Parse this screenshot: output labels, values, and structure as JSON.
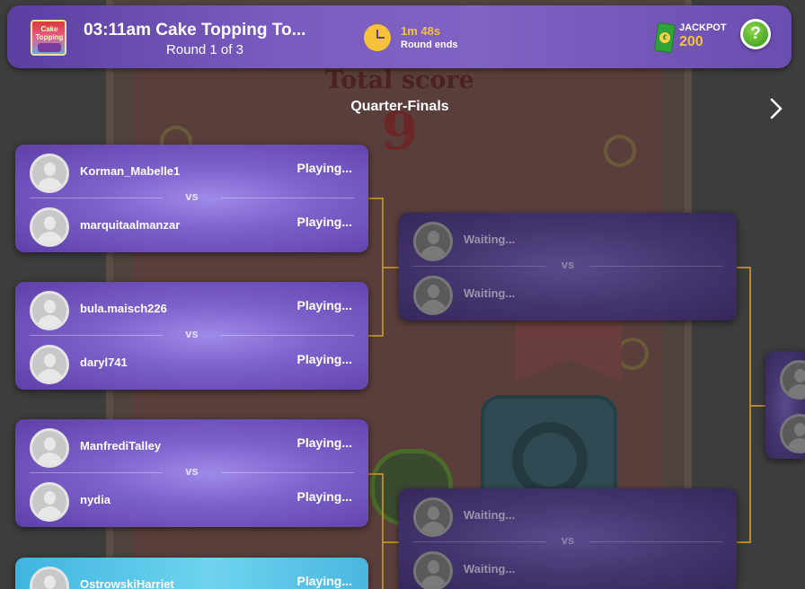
{
  "header": {
    "title": "03:11am Cake Topping To...",
    "round": "Round 1 of 3",
    "timer_value": "1m 48s",
    "timer_label": "Round ends",
    "jackpot_label": "JACKPOT",
    "jackpot_value": "200",
    "help_label": "?",
    "game_thumb_text": "Cake Topping"
  },
  "background": {
    "total_score_label": "Total score",
    "total_score_value": "9"
  },
  "bracket": {
    "stage_title": "Quarter-Finals",
    "vs_label": "vs",
    "quarter_finals": [
      {
        "player1": {
          "name": "Korman_Mabelle1",
          "status": "Playing..."
        },
        "player2": {
          "name": "marquitaalmanzar",
          "status": "Playing..."
        }
      },
      {
        "player1": {
          "name": "bula.maisch226",
          "status": "Playing..."
        },
        "player2": {
          "name": "daryl741",
          "status": "Playing..."
        }
      },
      {
        "player1": {
          "name": "ManfrediTalley",
          "status": "Playing..."
        },
        "player2": {
          "name": "nydia",
          "status": "Playing..."
        }
      },
      {
        "player1": {
          "name": "OstrowskiHarriet",
          "status": "Playing..."
        }
      }
    ],
    "semi_finals": [
      {
        "player1": {
          "name": "Waiting..."
        },
        "player2": {
          "name": "Waiting..."
        }
      },
      {
        "player1": {
          "name": "Waiting..."
        },
        "player2": {
          "name": "Waiting..."
        }
      }
    ]
  },
  "colors": {
    "accent_gold": "#f6c23a",
    "card_purple": "#7d62cc",
    "card_highlight_blue": "#3fb4e0",
    "bracket_line": "#b48a2a",
    "help_green": "#4ca82a"
  }
}
